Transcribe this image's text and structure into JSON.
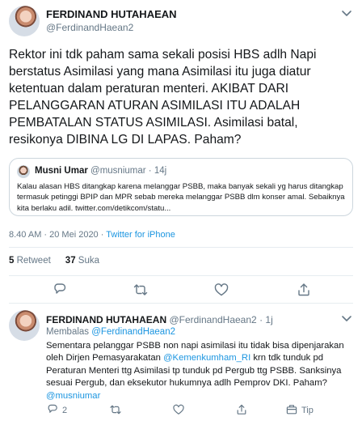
{
  "main_tweet": {
    "author_name": "FERDINAND HUTAHAEAN",
    "author_handle": "@FerdinandHaean2",
    "text": "Rektor ini tdk paham sama sekali posisi HBS adlh Napi berstatus Asimilasi yang mana Asimilasi itu juga diatur ketentuan dalam peraturan menteri. AKIBAT DARI PELANGGARAN ATURAN ASIMILASI ITU ADALAH PEMBATALAN STATUS ASIMILASI. Asimilasi batal, resikonya DIBINA LG DI LAPAS. Paham?",
    "timestamp": "8.40 AM · 20 Mei 2020 · ",
    "source": "Twitter for iPhone",
    "retweets_count": "5",
    "retweets_label": "Retweet",
    "likes_count": "37",
    "likes_label": "Suka"
  },
  "quoted_tweet": {
    "author_name": "Musni Umar",
    "author_handle": "@musniumar",
    "time": "14j",
    "text": "Kalau alasan HBS ditangkap  karena  melanggar PSBB, maka banyak sekali yg harus ditangkap termasuk petinggi BPIP dan MPR sebab mereka melanggar PSBB dlm konser amal. Sebaiknya kita berlaku adil. twitter.com/detikcom/statu..."
  },
  "reply_tweet": {
    "author_name": "FERDINAND HUTAHAEAN",
    "author_handle": "@FerdinandHaean2",
    "time": "1j",
    "replying_label": "Membalas ",
    "replying_to": "@FerdinandHaean2",
    "text_part1": "Sementara pelanggar PSBB non napi asimilasi itu tidak bisa dipenjarakan oleh Dirjen Pemasyarakatan ",
    "mention_1": "@Kemenkumham_RI",
    "text_part2": " krn tdk tunduk pd Peraturan Menteri ttg Asimilasi tp tunduk pd Pergub ttg PSBB. Sanksinya sesuai Pergub, dan eksekutor hukumnya adlh Pemprov DKI. Paham?",
    "mention_2": "@musniumar",
    "reply_count": "2",
    "tip_label": "Tip"
  },
  "colors": {
    "link": "#1b95e0",
    "secondary_text": "#657786",
    "border": "#e6ecf0"
  },
  "icons": [
    "chevron-down-icon",
    "reply-icon",
    "retweet-icon",
    "like-icon",
    "share-icon",
    "tip-icon"
  ]
}
